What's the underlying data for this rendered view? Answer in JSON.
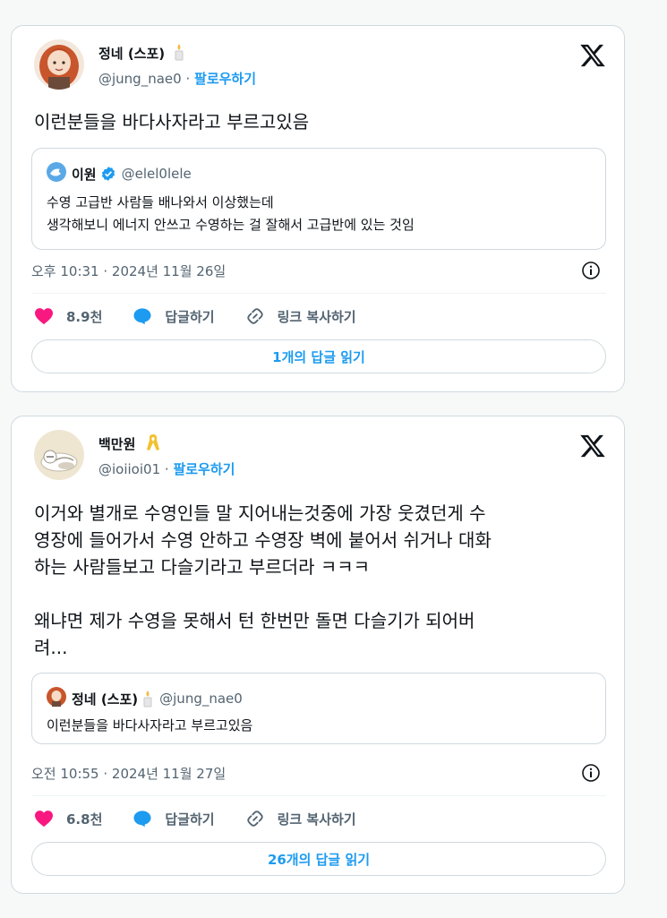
{
  "tweets": [
    {
      "author": {
        "name": "정네 (스포)",
        "handle": "@jung_nae0",
        "follow_label": "팔로우하기"
      },
      "text": "이런분들을 바다사자라고 부르고있음",
      "quote": {
        "name": "이원",
        "handle": "@elel0lele",
        "text": "수영 고급반 사람들 배나와서 이상했는데\n생각해보니 에너지 안쓰고 수영하는 걸 잘해서 고급반에 있는 것임"
      },
      "timestamp": "오후 10:31 · 2024년 11월 26일",
      "likes": "8.9천",
      "reply_label": "답글하기",
      "copy_link_label": "링크 복사하기",
      "read_replies_label": "1개의 답글 읽기"
    },
    {
      "author": {
        "name": "백만원",
        "handle": "@ioiioi01",
        "follow_label": "팔로우하기"
      },
      "text": "이거와 별개로 수영인들 말 지어내는것중에 가장 웃겼던게 수\n영장에 들어가서 수영 안하고 수영장 벽에 붙어서 쉬거나 대화\n하는 사람들보고 다슬기라고 부르더라 ㅋㅋㅋ\n\n왜냐면 제가 수영을 못해서 턴 한번만 돌면 다슬기가 되어버\n려...",
      "quote": {
        "name": "정네 (스포)",
        "handle": "@jung_nae0",
        "text": "이런분들을 바다사자라고 부르고있음"
      },
      "timestamp": "오전 10:55 · 2024년 11월 27일",
      "likes": "6.8천",
      "reply_label": "답글하기",
      "copy_link_label": "링크 복사하기",
      "read_replies_label": "26개의 답글 읽기"
    }
  ],
  "colors": {
    "accent": "#1d9bf0",
    "like": "#f91880",
    "muted": "#536471",
    "border": "#cfd9de"
  },
  "icons": [
    "x-logo-icon",
    "candle-icon",
    "ribbon-icon",
    "verified-badge-icon",
    "info-icon",
    "heart-icon",
    "reply-icon",
    "link-icon"
  ]
}
